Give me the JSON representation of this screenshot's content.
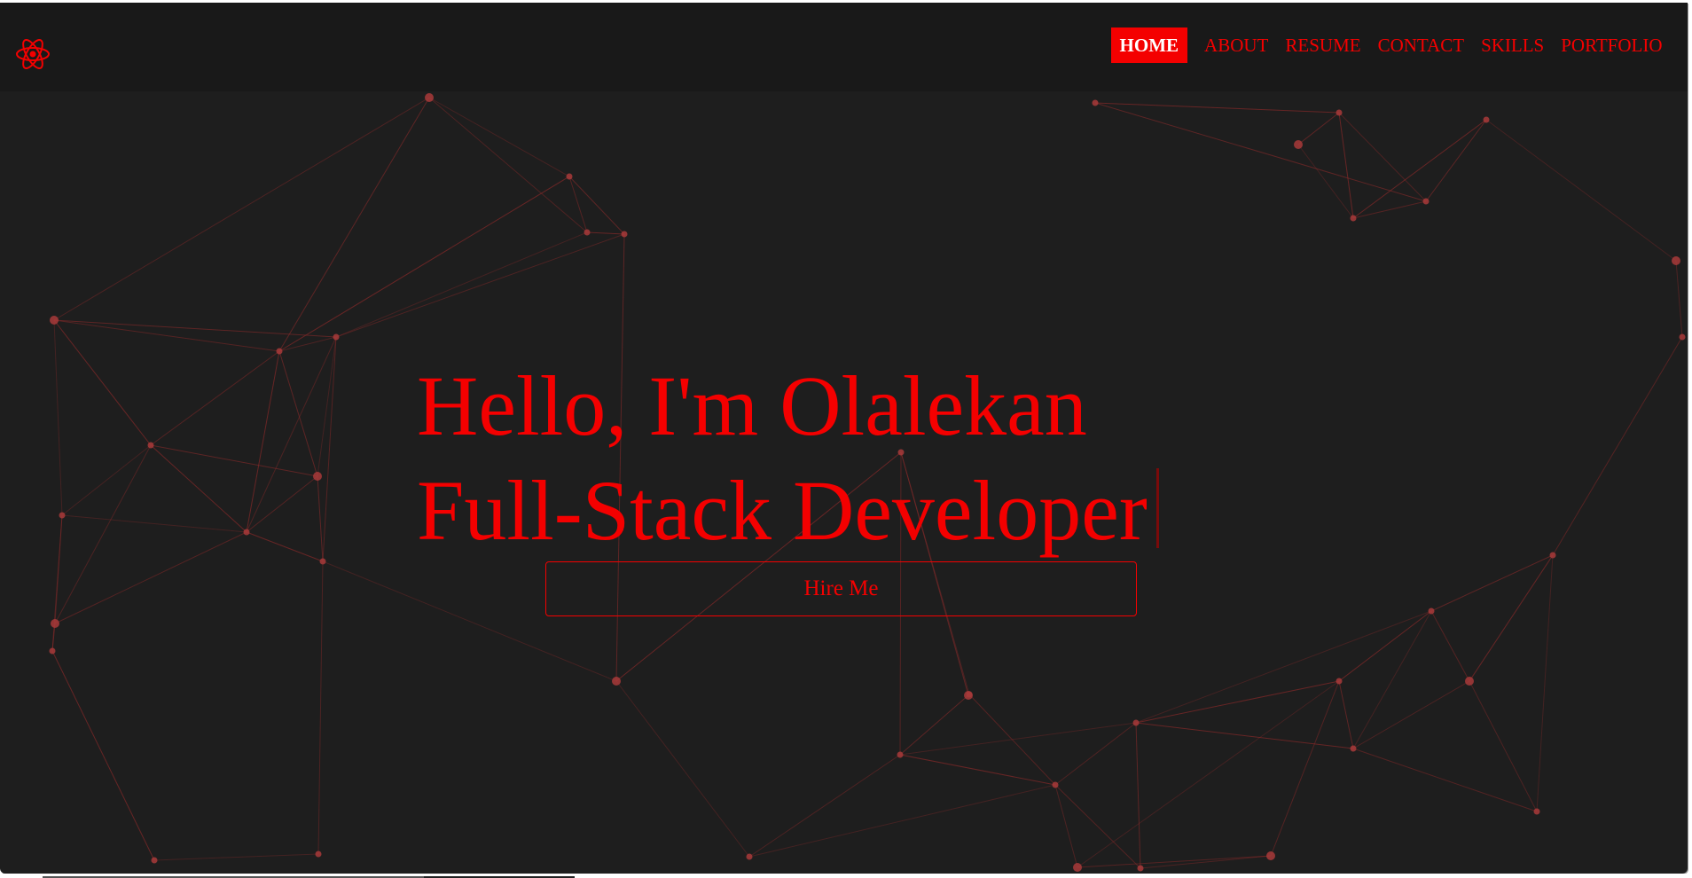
{
  "brand": {
    "logo_icon": "react-atom-icon",
    "accent_color": "#f40000",
    "background_color": "#1e1e1e",
    "navbar_color": "#191919"
  },
  "nav": {
    "items": [
      {
        "label": "HOME",
        "active": true
      },
      {
        "label": "ABOUT",
        "active": false
      },
      {
        "label": "RESUME",
        "active": false
      },
      {
        "label": "CONTACT",
        "active": false
      },
      {
        "label": "SKILLS",
        "active": false
      },
      {
        "label": "PORTFOLIO",
        "active": false
      }
    ]
  },
  "hero": {
    "greeting": "Hello, I'm Olalekan",
    "role": "Full-Stack Developer",
    "cta_label": "Hire Me"
  }
}
